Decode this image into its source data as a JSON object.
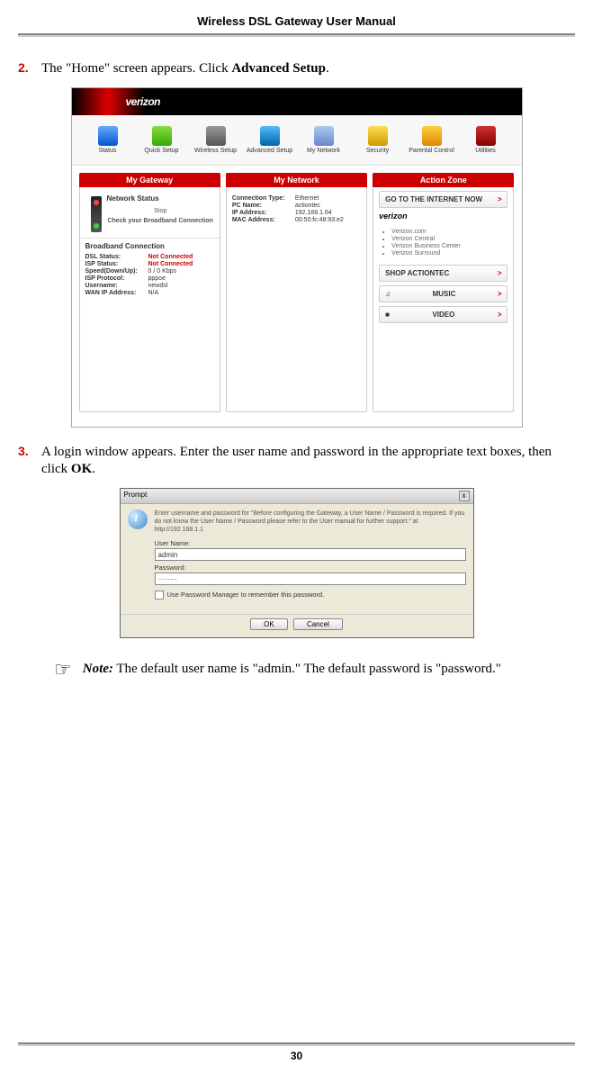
{
  "header": {
    "title": "Wireless DSL Gateway User Manual"
  },
  "step2": {
    "num": "2.",
    "text_a": "The \"Home\" screen appears. Click ",
    "bold": "Advanced Setup",
    "text_b": "."
  },
  "router": {
    "logo_verizon": "verizon",
    "nav": [
      "Status",
      "Quick Setup",
      "Wireless Setup",
      "Advanced Setup",
      "My Network",
      "Security",
      "Parental Control",
      "Utilities"
    ],
    "col_headers": [
      "My Gateway",
      "My Network",
      "Action Zone"
    ],
    "gw": {
      "netstat_title": "Network Status",
      "stop": "Stop",
      "check": "Check your Broadband Connection",
      "bb_title": "Broadband Connection",
      "kv": [
        {
          "k": "DSL Status:",
          "v": "Not Connected",
          "red": true
        },
        {
          "k": "ISP Status:",
          "v": "Not Connected",
          "red": true
        },
        {
          "k": "Speed(Down/Up):",
          "v": "0 / 0 Kbps"
        },
        {
          "k": "ISP Protocol:",
          "v": "pppoe"
        },
        {
          "k": "Username:",
          "v": "newdsl"
        },
        {
          "k": "WAN IP Address:",
          "v": "N/A"
        }
      ]
    },
    "net": {
      "kv": [
        {
          "k": "Connection Type:",
          "v": "Ethernet"
        },
        {
          "k": "PC Name:",
          "v": "actiontec"
        },
        {
          "k": "IP Address:",
          "v": "192.168.1.64"
        },
        {
          "k": "MAC Address:",
          "v": "00:50:fc:48:93:e2"
        }
      ]
    },
    "az": {
      "go": "GO TO THE INTERNET NOW",
      "vz": "verizon",
      "links": [
        "Verizon.com",
        "Verizon Central",
        "Verizon Business Center",
        "Verizon Surround"
      ],
      "btns": [
        "SHOP ACTIONTEC",
        "MUSIC",
        "VIDEO"
      ],
      "arrow": ">"
    }
  },
  "step3": {
    "num": "3.",
    "text_a": " A login window appears. Enter the user name and password in the appropriate text boxes, then click ",
    "bold": "OK",
    "text_b": "."
  },
  "prompt": {
    "title": "Prompt",
    "close": "x",
    "text": "Enter username and password for \"Before configuring the Gateway, a User Name / Password is required. If you do not know the User Name / Password please refer to the User manual for further support.\" at http://192.168.1.1",
    "user_lbl": "User Name:",
    "user_val": "admin",
    "pass_lbl": "Password:",
    "pass_val": "········",
    "remember": "Use Password Manager to remember this password.",
    "ok": "OK",
    "cancel": "Cancel"
  },
  "note": {
    "hand": "☞",
    "bold": "Note:",
    "text": " The default user name is \"admin.\" The default password is \"password.\""
  },
  "footer": {
    "page": "30"
  }
}
